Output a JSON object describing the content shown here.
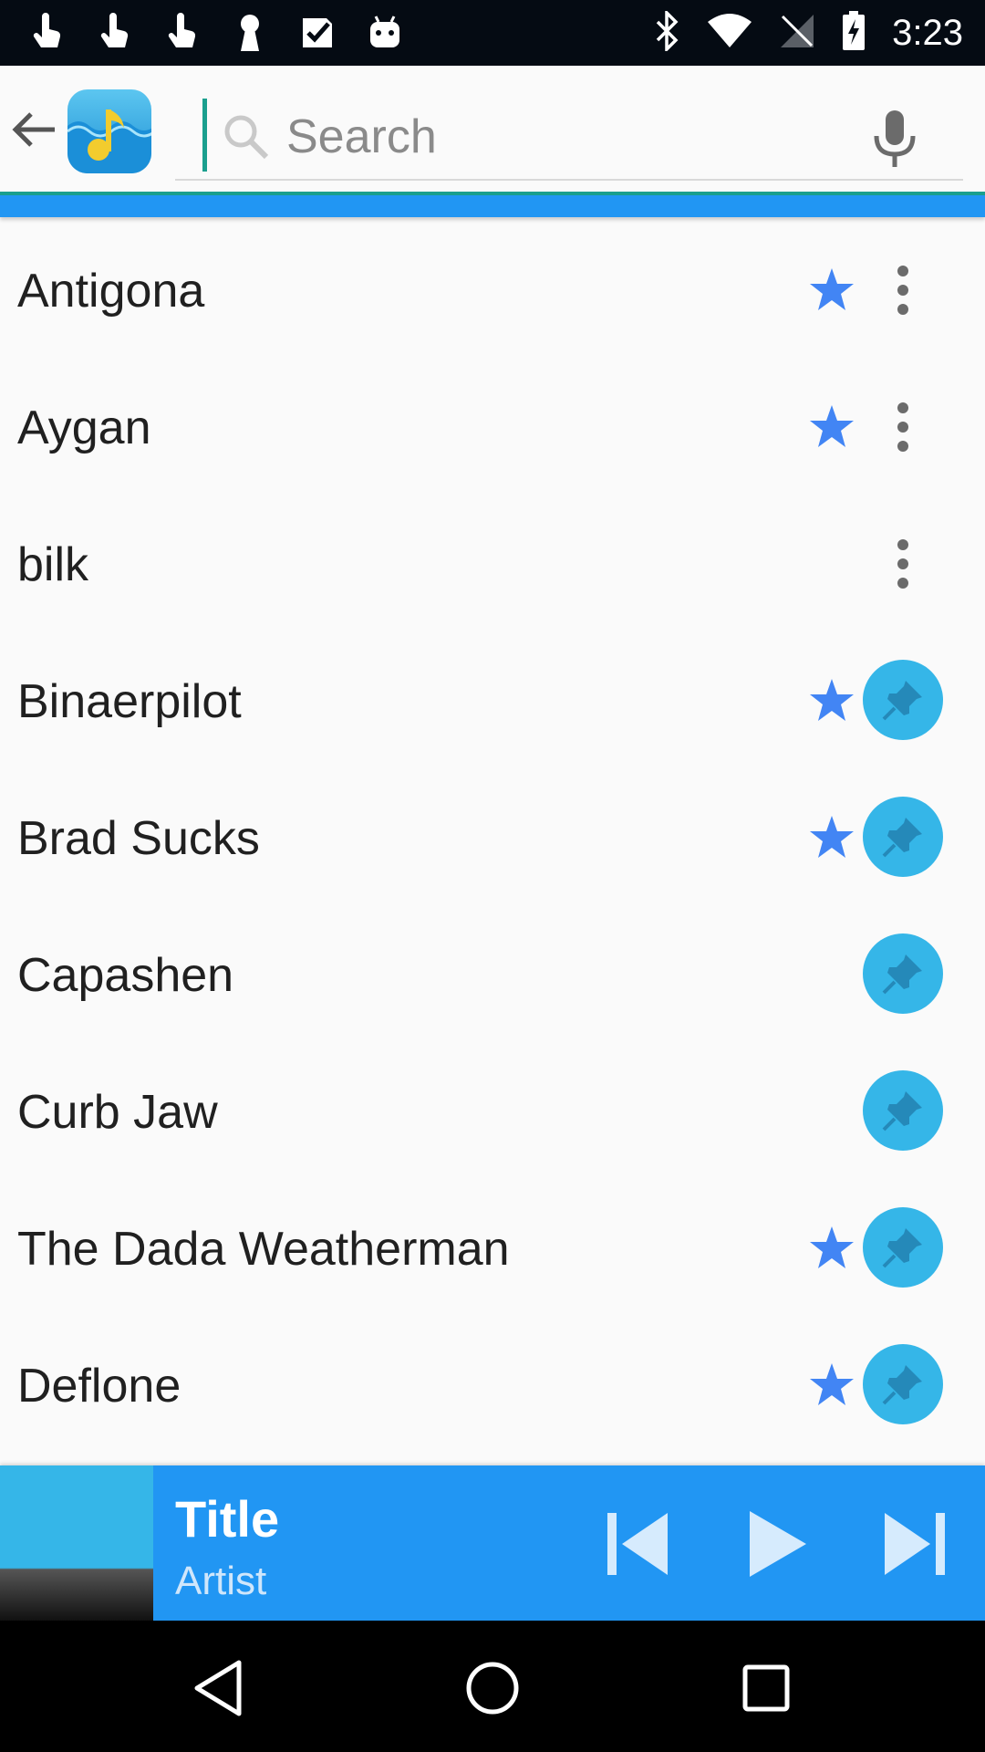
{
  "status_bar": {
    "time": "3:23",
    "left_icons": [
      "touch-icon",
      "touch-icon",
      "touch-icon",
      "keyhole-icon",
      "check-icon",
      "android-icon"
    ],
    "right_icons": [
      "bluetooth-icon",
      "wifi-icon",
      "no-sim-icon",
      "battery-charging-icon"
    ]
  },
  "toolbar": {
    "search_placeholder": "Search"
  },
  "colors": {
    "accent": "#2196f3",
    "light_blue": "#35b6e8",
    "star": "#4285f4",
    "cursor": "#1a9f8e"
  },
  "list": {
    "items": [
      {
        "label": "Antigona",
        "starred": true,
        "action": "more"
      },
      {
        "label": "Aygan",
        "starred": true,
        "action": "more"
      },
      {
        "label": "bilk",
        "starred": false,
        "action": "more"
      },
      {
        "label": "Binaerpilot",
        "starred": true,
        "action": "pin"
      },
      {
        "label": "Brad Sucks",
        "starred": true,
        "action": "pin"
      },
      {
        "label": "Capashen",
        "starred": false,
        "action": "pin"
      },
      {
        "label": "Curb Jaw",
        "starred": false,
        "action": "pin"
      },
      {
        "label": "The Dada Weatherman",
        "starred": true,
        "action": "pin"
      },
      {
        "label": "Deflone",
        "starred": true,
        "action": "pin"
      }
    ]
  },
  "now_playing": {
    "title": "Title",
    "artist": "Artist"
  }
}
